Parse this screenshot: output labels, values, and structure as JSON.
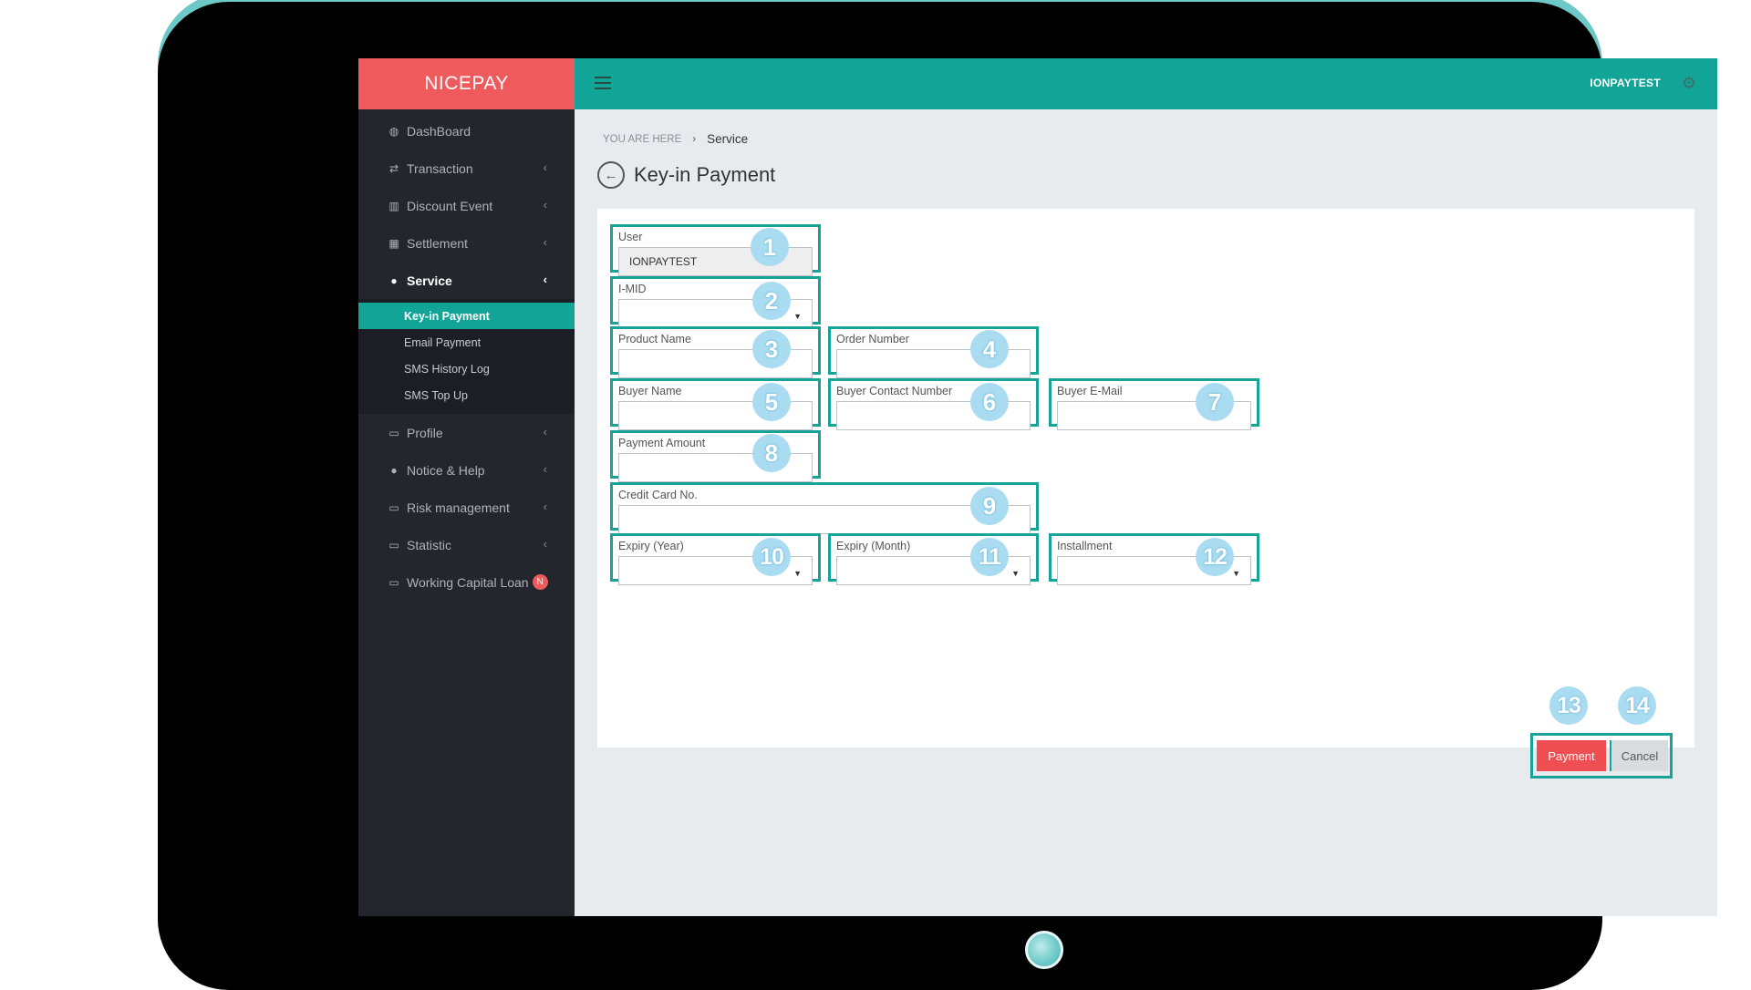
{
  "app": {
    "brand": "NICEPAY"
  },
  "topbar": {
    "user": "IONPAYTEST"
  },
  "sidebar": {
    "items": [
      {
        "label": "DashBoard"
      },
      {
        "label": "Transaction"
      },
      {
        "label": "Discount Event"
      },
      {
        "label": "Settlement"
      },
      {
        "label": "Service"
      },
      {
        "label": "Profile"
      },
      {
        "label": "Notice & Help"
      },
      {
        "label": "Risk management"
      },
      {
        "label": "Statistic"
      },
      {
        "label": "Working Capital Loan",
        "badge": "N"
      }
    ],
    "service_sub": [
      {
        "label": "Key-in Payment"
      },
      {
        "label": "Email Payment"
      },
      {
        "label": "SMS History Log"
      },
      {
        "label": "SMS Top Up"
      }
    ]
  },
  "breadcrumb": {
    "prefix": "YOU ARE HERE",
    "separator": "›",
    "current": "Service"
  },
  "page": {
    "title": "Key-in Payment"
  },
  "form": {
    "user": {
      "label": "User",
      "value": "IONPAYTEST"
    },
    "imid": {
      "label": "I-MID",
      "value": ""
    },
    "product_name": {
      "label": "Product Name",
      "value": ""
    },
    "order_number": {
      "label": "Order Number",
      "value": ""
    },
    "buyer_name": {
      "label": "Buyer Name",
      "value": ""
    },
    "buyer_contact": {
      "label": "Buyer Contact Number",
      "value": ""
    },
    "buyer_email": {
      "label": "Buyer E-Mail",
      "value": ""
    },
    "payment_amount": {
      "label": "Payment Amount",
      "value": ""
    },
    "credit_card": {
      "label": "Credit Card No.",
      "value": ""
    },
    "expiry_year": {
      "label": "Expiry (Year)",
      "value": ""
    },
    "expiry_month": {
      "label": "Expiry (Month)",
      "value": ""
    },
    "installment": {
      "label": "Installment",
      "value": ""
    },
    "payment_button": "Payment",
    "cancel_button": "Cancel"
  },
  "callouts": [
    "1",
    "2",
    "3",
    "4",
    "5",
    "6",
    "7",
    "8",
    "9",
    "10",
    "11",
    "12",
    "13",
    "14"
  ],
  "colors": {
    "brand_red": "#ef5a5c",
    "teal": "#12a597",
    "sidebar_bg": "#23262d",
    "callout": "#a9dbf1"
  }
}
